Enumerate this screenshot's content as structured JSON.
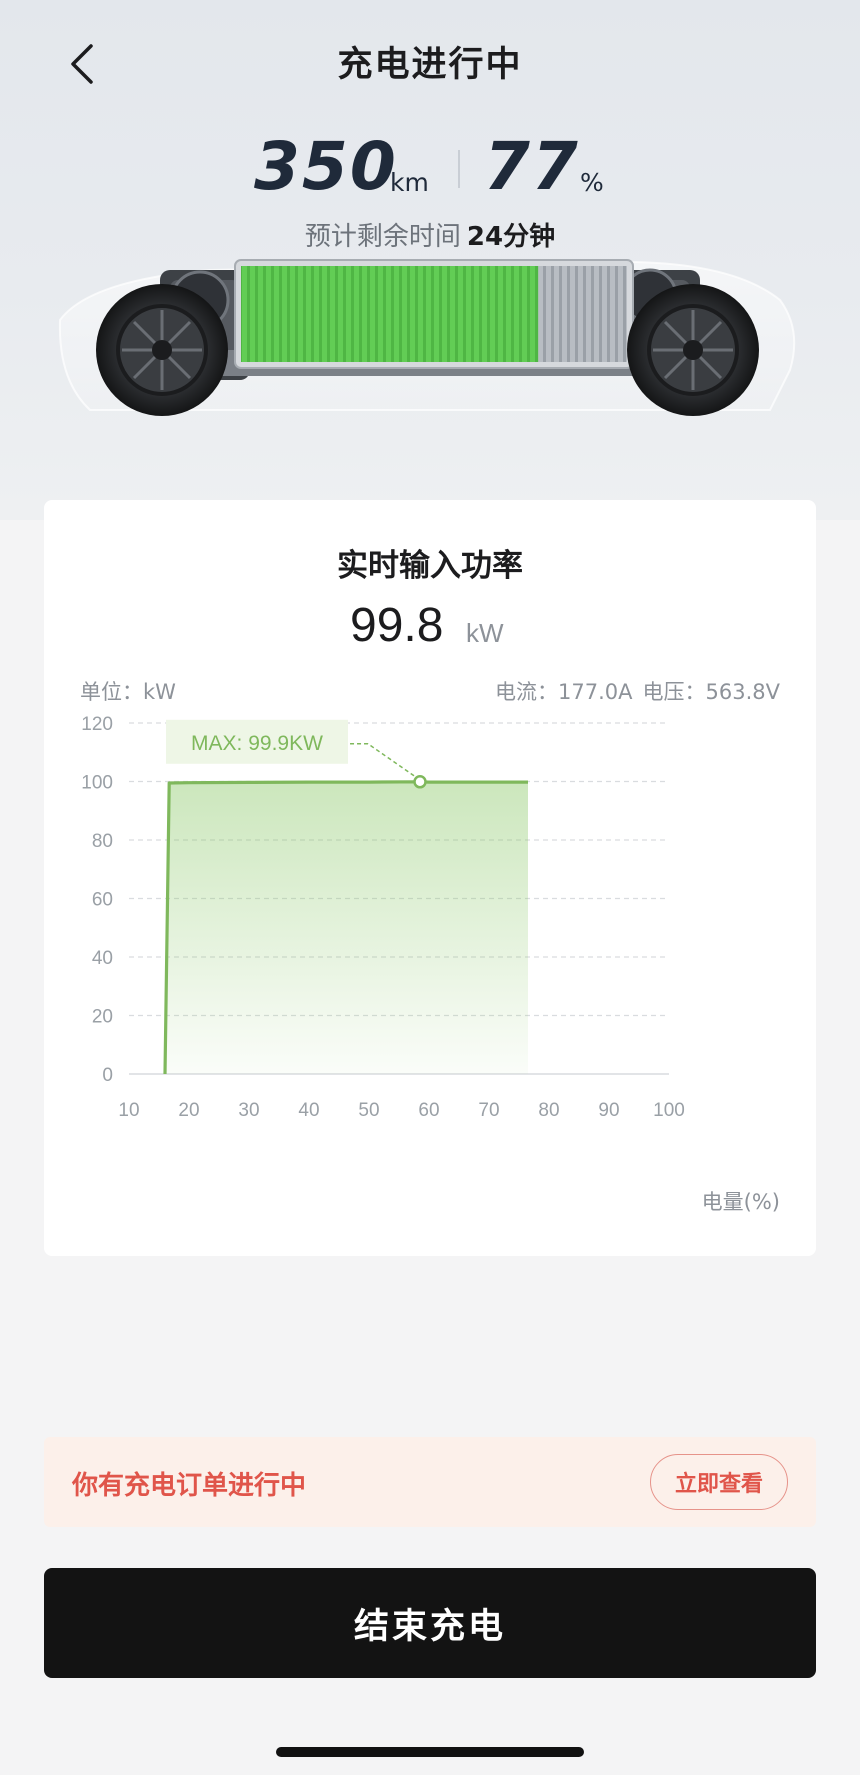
{
  "header": {
    "title": "充电进行中"
  },
  "stats": {
    "range_value": "350",
    "range_unit": "km",
    "soc_value": "77",
    "soc_unit": "%",
    "remaining_label": "预计剩余时间",
    "remaining_value": "24分钟"
  },
  "battery": {
    "charge_fraction": 0.77
  },
  "power_card": {
    "title": "实时输入功率",
    "power_value": "99.8",
    "power_unit": "kW",
    "unit_label": "单位：kW",
    "current_label": "电流：177.0A",
    "voltage_label": "电压：563.8V",
    "x_axis_label": "电量(%)"
  },
  "chart_data": {
    "type": "area",
    "x": [
      16,
      16.7,
      20,
      30,
      40,
      50,
      58.5,
      60,
      70,
      76.5
    ],
    "y": [
      0,
      99.5,
      99.6,
      99.7,
      99.8,
      99.8,
      99.9,
      99.8,
      99.8,
      99.8
    ],
    "xlim": [
      10,
      100
    ],
    "ylim": [
      0,
      120
    ],
    "x_ticks": [
      "10",
      "20",
      "30",
      "40",
      "50",
      "60",
      "70",
      "80",
      "90",
      "100"
    ],
    "y_ticks": [
      "0",
      "20",
      "40",
      "60",
      "80",
      "100",
      "120"
    ],
    "max_point": {
      "x": 58.5,
      "y": 99.9
    },
    "max_label": "MAX: 99.9KW",
    "grid": true,
    "colors": {
      "line": "#7fb85c",
      "fill": "#8dc96b",
      "label_bg": "#eef6e6",
      "label_text": "#7fb85c"
    }
  },
  "order_banner": {
    "text": "你有充电订单进行中",
    "button_label": "立即查看"
  },
  "actions": {
    "end_button_label": "结束充电"
  },
  "icons": {
    "back": "chevron-left-icon"
  },
  "colors": {
    "accent_red": "#e0554a",
    "battery_green": "#5cc852",
    "end_button_bg": "#131313"
  }
}
